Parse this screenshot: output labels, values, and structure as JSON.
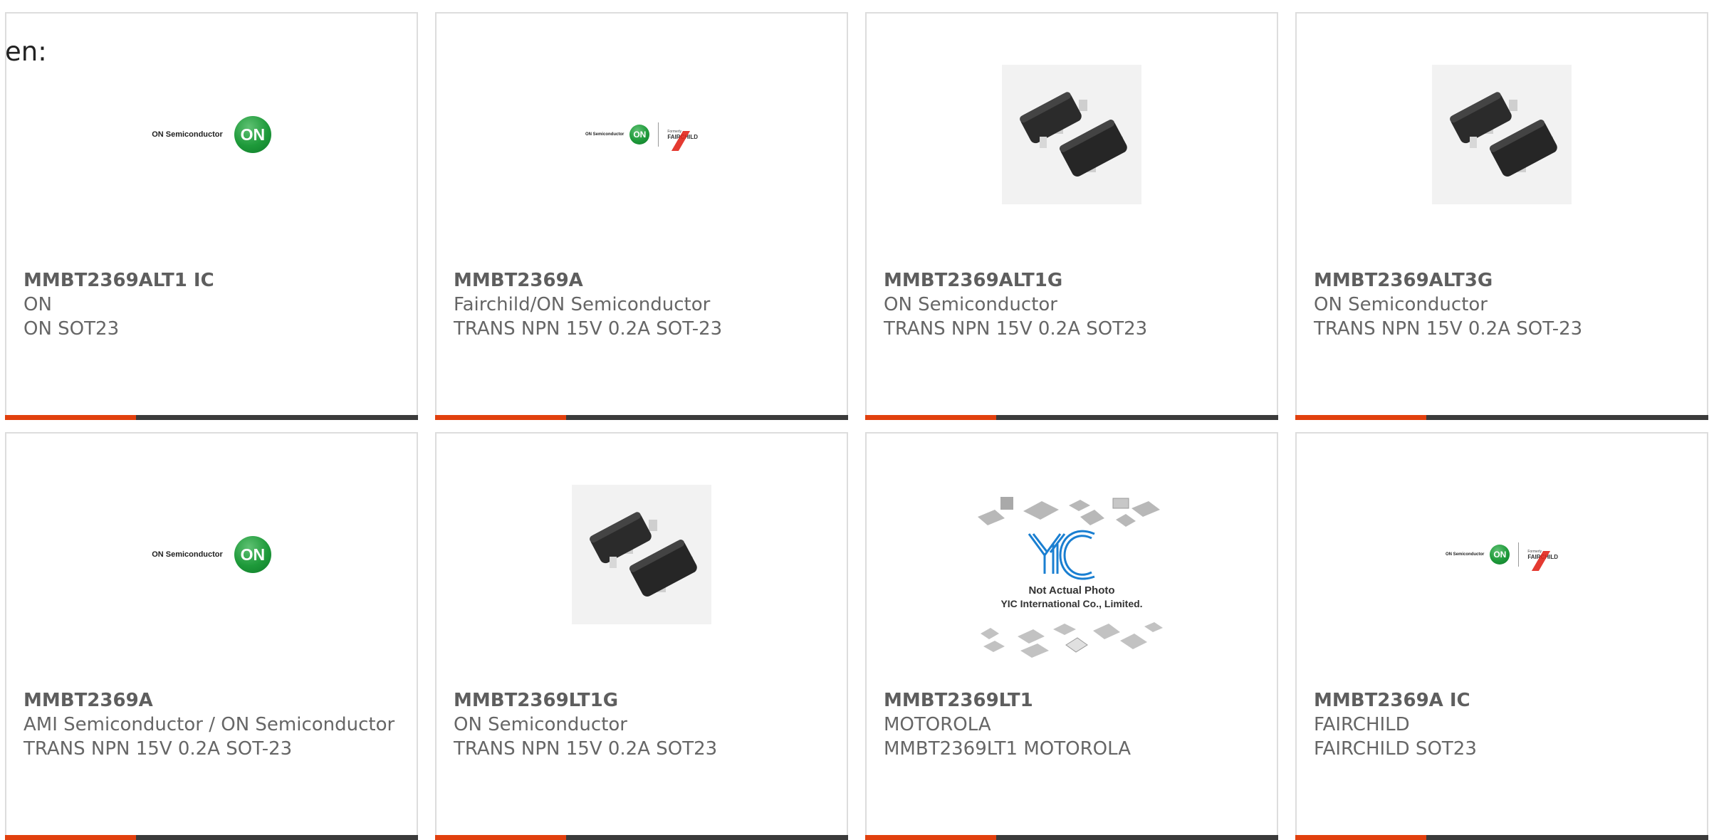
{
  "lang_label": "en:",
  "logos": {
    "on_text": "ON Semiconductor",
    "on_mark": "ON",
    "formerly": "Formerly",
    "fairchild": "FAIRCHILD"
  },
  "products": [
    {
      "part": "MMBT2369ALT1 IC",
      "maker": "ON",
      "desc": "ON SOT23",
      "image": "on-semiconductor-logo"
    },
    {
      "part": "MMBT2369A",
      "maker": "Fairchild/ON Semiconductor",
      "desc": "TRANS NPN 15V 0.2A SOT-23",
      "image": "on-fairchild-logo"
    },
    {
      "part": "MMBT2369ALT1G",
      "maker": "ON Semiconductor",
      "desc": "TRANS NPN 15V 0.2A SOT23",
      "image": "sot23-package-photo"
    },
    {
      "part": "MMBT2369ALT3G",
      "maker": "ON Semiconductor",
      "desc": "TRANS NPN 15V 0.2A SOT-23",
      "image": "sot23-package-photo"
    },
    {
      "part": "MMBT2369A",
      "maker": "AMI Semiconductor / ON Semiconductor",
      "desc": "TRANS NPN 15V 0.2A SOT-23",
      "image": "on-semiconductor-logo"
    },
    {
      "part": "MMBT2369LT1G",
      "maker": "ON Semiconductor",
      "desc": "TRANS NPN 15V 0.2A SOT23",
      "image": "sot23-package-photo"
    },
    {
      "part": "MMBT2369LT1",
      "maker": "MOTOROLA",
      "desc": "MMBT2369LT1 MOTOROLA",
      "image": "yic-placeholder"
    },
    {
      "part": "MMBT2369A IC",
      "maker": "FAIRCHILD",
      "desc": "FAIRCHILD SOT23",
      "image": "on-fairchild-logo"
    }
  ],
  "placeholder": {
    "line1": "Not Actual Photo",
    "line2": "YIC International Co., Limited."
  },
  "colors": {
    "accent": "#e1400e",
    "bar": "#3b3b3b",
    "text": "#666666",
    "on_green": "#1e9a3a"
  }
}
